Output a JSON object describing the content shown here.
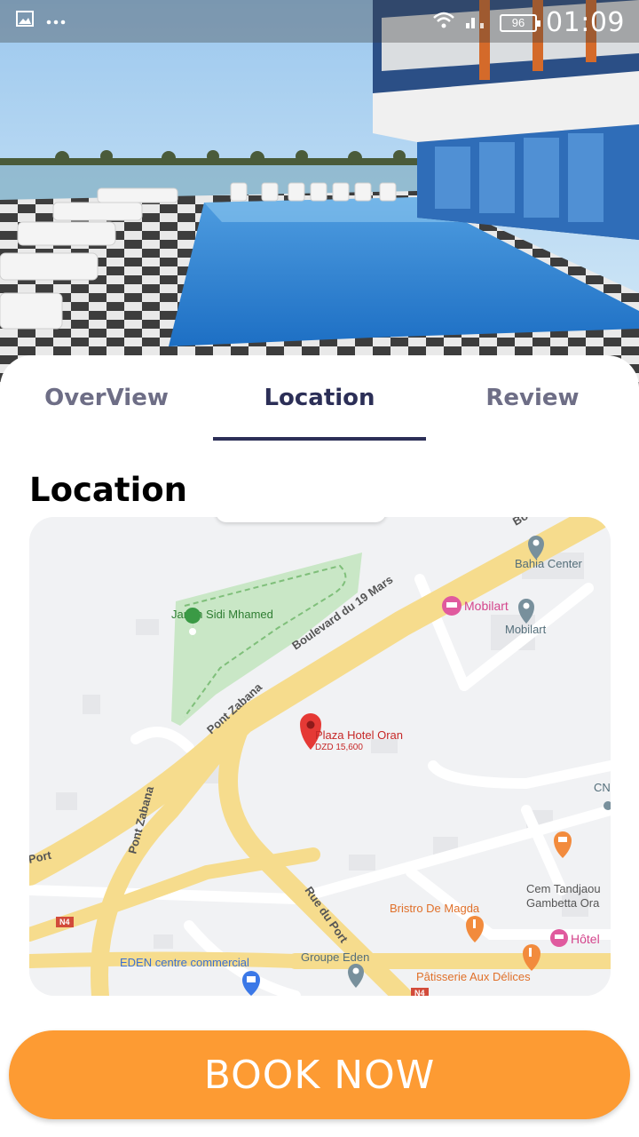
{
  "status_bar": {
    "time": "01:09",
    "battery": "96",
    "sim": "1"
  },
  "tabs": [
    {
      "label": "OverView",
      "active": false
    },
    {
      "label": "Location",
      "active": true
    },
    {
      "label": "Review",
      "active": false
    }
  ],
  "section": {
    "title": "Location"
  },
  "map": {
    "roads": [
      "Boulevard du 19 Mars",
      "Pont Zabana",
      "Pont Zabana",
      "Rue du Port",
      "Port",
      "N4",
      "N4",
      "Bo"
    ],
    "places": {
      "park": "Jardin Sidi Mhamed",
      "hotel_name": "Plaza Hotel Oran",
      "hotel_price": "DZD 15,600",
      "bahia": "Bahia Center",
      "mobilart_pink": "Mobilart",
      "mobilart_grey": "Mobilart",
      "cem_line1": "Cem Tandjaou",
      "cem_line2": "Gambetta Ora",
      "bristro": "Bristro De Magda",
      "hotel_right": "Hôtel",
      "eden_cc": "EDEN centre commercial",
      "groupe_eden": "Groupe Eden",
      "patisserie": "Pâtisserie Aux Délices",
      "cn": "CN"
    }
  },
  "book_button": {
    "label": "BOOK NOW"
  },
  "colors": {
    "accent": "#fd9b33",
    "tab_active": "#2c2f57",
    "tab_inactive": "#6e6e86"
  }
}
